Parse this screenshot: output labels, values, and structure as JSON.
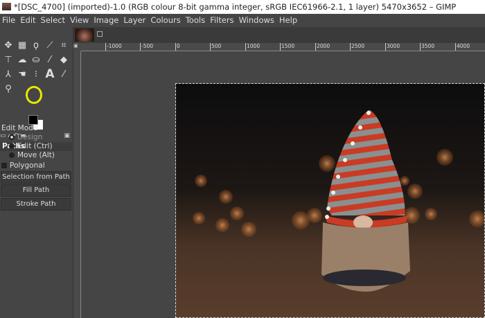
{
  "window": {
    "title": "*[DSC_4700] (imported)-1.0 (RGB colour 8-bit gamma integer, sRGB IEC61966-2.1, 1 layer) 5470x3652 – GIMP"
  },
  "menu": [
    "File",
    "Edit",
    "Select",
    "View",
    "Image",
    "Layer",
    "Colours",
    "Tools",
    "Filters",
    "Windows",
    "Help"
  ],
  "tools": [
    "move-icon",
    "rect-select-icon",
    "lasso-icon",
    "fuzzy-select-icon",
    "crop-icon",
    "unified-transform-icon",
    "warp-icon",
    "bucket-fill-icon",
    "paintbrush-icon",
    "eraser-icon",
    "clone-icon",
    "smudge-icon",
    "paths-icon",
    "text-icon",
    "color-picker-icon",
    "zoom-icon"
  ],
  "colors": {
    "foreground": "#000000",
    "background": "#ffffff",
    "highlight": "#e8e800"
  },
  "tool_options": {
    "title": "Paths",
    "edit_mode_label": "Edit Mode",
    "modes": [
      "Design",
      "Edit (Ctrl)",
      "Move (Alt)"
    ],
    "selected_mode": "Design",
    "polygonal_label": "Polygonal",
    "polygonal_checked": false,
    "buttons": [
      "Selection from Path",
      "Fill Path",
      "Stroke Path"
    ]
  },
  "ruler": {
    "ticks": [
      "-1000",
      "-500",
      "0",
      "500",
      "1000",
      "1500",
      "2000",
      "2500",
      "3000",
      "3500",
      "4000"
    ]
  }
}
